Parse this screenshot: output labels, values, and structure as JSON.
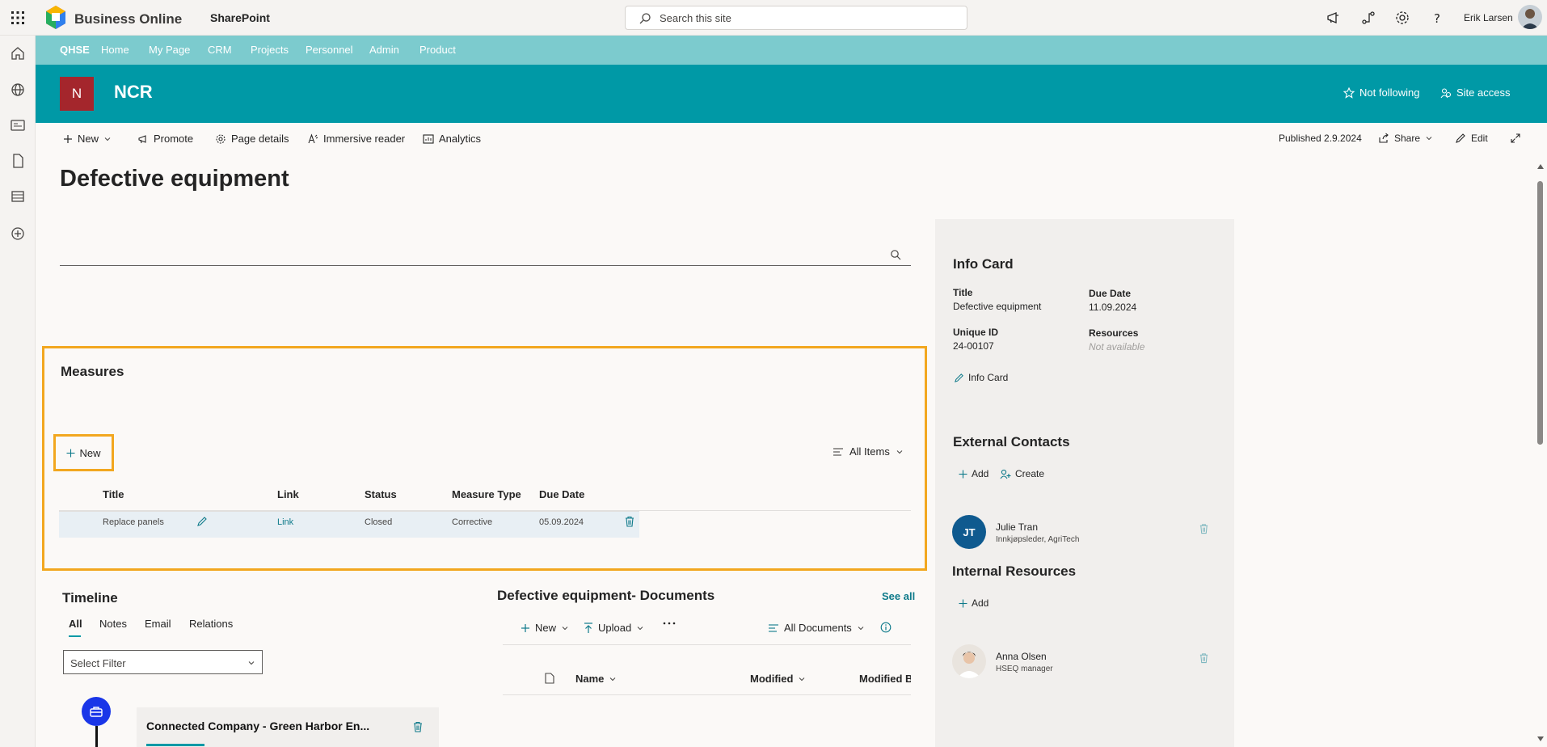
{
  "suite": {
    "brand": "Business Online",
    "app": "SharePoint",
    "search_placeholder": "Search this site",
    "user": "Erik Larsen"
  },
  "hubnav": [
    "QHSE",
    "Home",
    "My Page",
    "CRM",
    "Projects",
    "Personnel",
    "Admin",
    "Product"
  ],
  "site": {
    "logo_letter": "N",
    "title": "NCR",
    "following": "Not following",
    "access": "Site access"
  },
  "commandbar": {
    "new": "New",
    "promote": "Promote",
    "page_details": "Page details",
    "immersive": "Immersive reader",
    "analytics": "Analytics",
    "published": "Published 2.9.2024",
    "share": "Share",
    "edit": "Edit"
  },
  "page": {
    "title": "Defective equipment"
  },
  "measures": {
    "title": "Measures",
    "new": "New",
    "view": "All Items",
    "columns": [
      "Title",
      "Link",
      "Status",
      "Measure Type",
      "Due Date"
    ],
    "rows": [
      {
        "title": "Replace panels",
        "link": "Link",
        "status": "Closed",
        "type": "Corrective",
        "due": "05.09.2024"
      }
    ]
  },
  "timeline": {
    "title": "Timeline",
    "tabs": [
      "All",
      "Notes",
      "Email",
      "Relations"
    ],
    "filter_placeholder": "Select Filter",
    "card_title": "Connected Company - Green Harbor En..."
  },
  "documents": {
    "title": "Defective equipment- Documents",
    "see_all": "See all",
    "new": "New",
    "upload": "Upload",
    "view": "All Documents",
    "columns": [
      "Name",
      "Modified",
      "Modified By"
    ]
  },
  "infocard": {
    "title": "Info Card",
    "title_label": "Title",
    "title_value": "Defective equipment",
    "due_label": "Due Date",
    "due_value": "11.09.2024",
    "uid_label": "Unique ID",
    "uid_value": "24-00107",
    "res_label": "Resources",
    "res_value": "Not available",
    "edit_label": "Info Card"
  },
  "external": {
    "title": "External Contacts",
    "add": "Add",
    "create": "Create",
    "person": {
      "initials": "JT",
      "name": "Julie Tran",
      "role": "Innkjøpsleder, AgriTech"
    }
  },
  "internal": {
    "title": "Internal Resources",
    "add": "Add",
    "person": {
      "name": "Anna Olsen",
      "role": "HSEQ manager"
    }
  },
  "colors": {
    "teal": "#0099a6",
    "hub": "#7ccbce",
    "highlight": "#f2a71f",
    "logo_red": "#a4262c"
  }
}
